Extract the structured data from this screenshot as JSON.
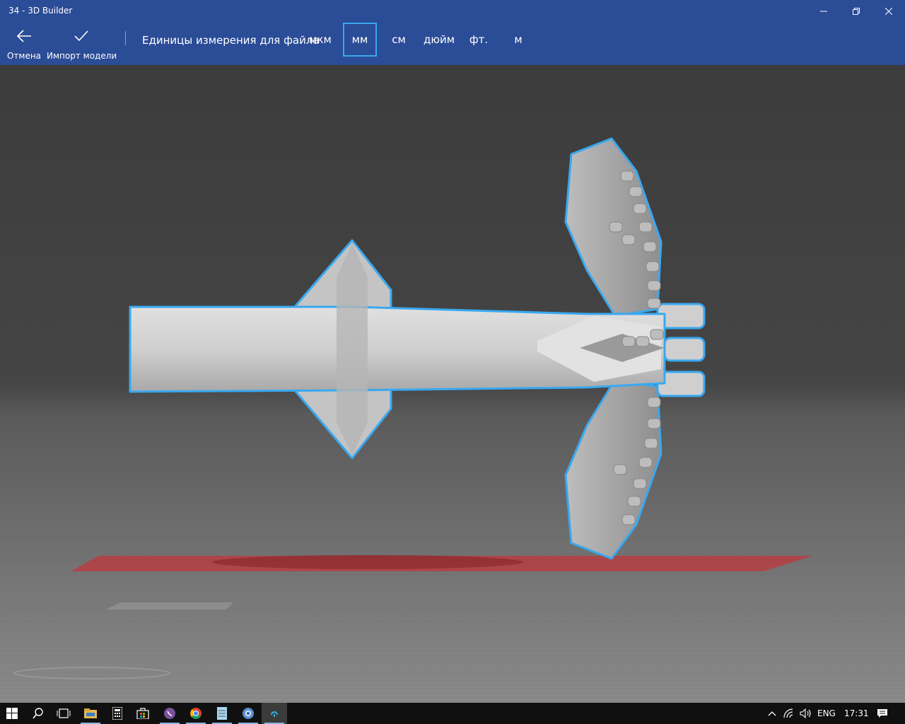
{
  "window": {
    "title": "34 - 3D Builder"
  },
  "commands": {
    "cancel_label": "Отмена",
    "import_label": "Импорт модели"
  },
  "units": {
    "label": "Единицы измерения для файла",
    "options": [
      "мкм",
      "мм",
      "см",
      "дюйм",
      "фт.",
      "м"
    ],
    "selected": "мм"
  },
  "colors": {
    "titlebar": "#2b4c96",
    "accent": "#39a8f0",
    "model": "#d6d6d6",
    "ground": "#c0373c"
  },
  "taskbar": {
    "apps": [
      "start-icon",
      "search-icon",
      "task-view-icon",
      "file-explorer-icon",
      "calculator-icon",
      "store-icon",
      "viber-icon",
      "chrome-icon",
      "notepad-icon",
      "chromium-icon",
      "3d-builder-icon"
    ],
    "tray": {
      "language": "ENG",
      "time": "17:31"
    }
  }
}
